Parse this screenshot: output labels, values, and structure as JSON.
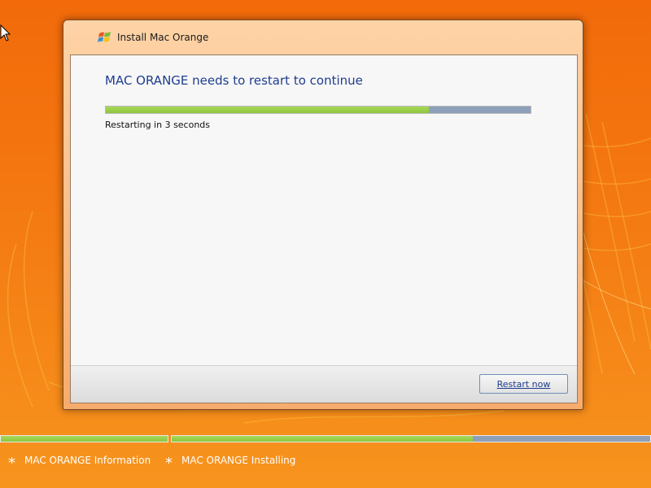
{
  "window": {
    "title": "Install Mac Orange",
    "heading": "MAC ORANGE needs to restart to continue",
    "progress_fraction": 0.76,
    "status": "Restarting in 3 seconds",
    "restart_button": "Restart now"
  },
  "install_steps": {
    "bar1_fraction": 1.0,
    "bar2_fraction": 0.63,
    "items": [
      {
        "icon": "asterisk-icon",
        "label": "MAC ORANGE Information"
      },
      {
        "icon": "asterisk-icon",
        "label": "MAC ORANGE Installing"
      }
    ]
  },
  "colors": {
    "background": "#f26a0a",
    "progress_fill": "#8cc63e",
    "progress_track": "#8ea0b9",
    "heading": "#1e3d8f"
  }
}
